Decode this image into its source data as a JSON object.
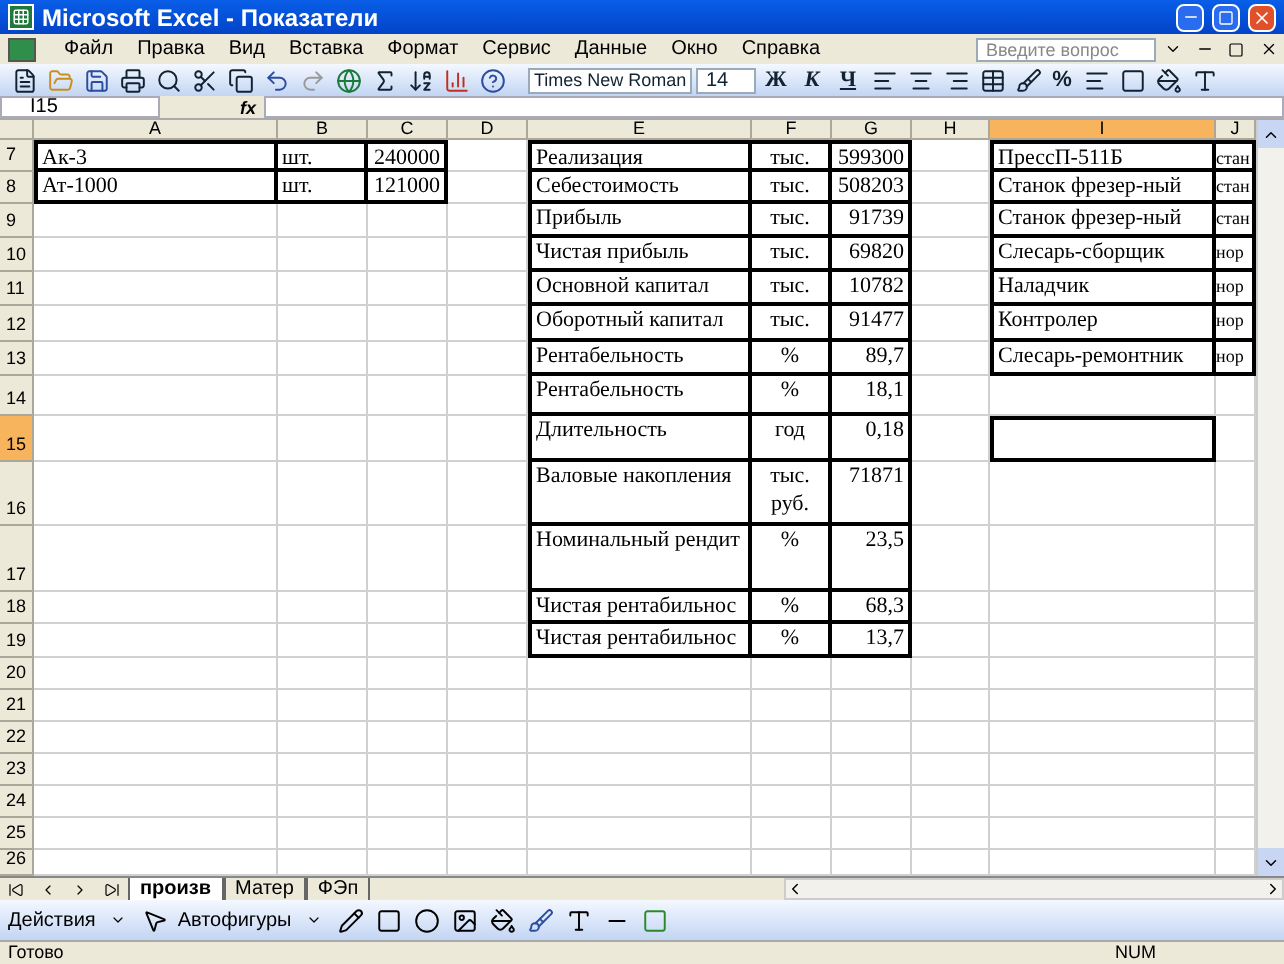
{
  "window": {
    "title": "Microsoft Excel - Показатели"
  },
  "menu": [
    {
      "label": "Файл"
    },
    {
      "label": "Правка"
    },
    {
      "label": "Вид"
    },
    {
      "label": "Вставка"
    },
    {
      "label": "Формат"
    },
    {
      "label": "Сервис"
    },
    {
      "label": "Данные"
    },
    {
      "label": "Окно"
    },
    {
      "label": "Справка"
    }
  ],
  "help_search": {
    "placeholder": "Введите вопрос"
  },
  "toolbar": {
    "font": "Times New Roman",
    "size": "14",
    "bold": "Ж",
    "italic": "К",
    "underline": "Ч",
    "percent": "%"
  },
  "formula_bar": {
    "name_box": "I15",
    "fx": "fx"
  },
  "columns": [
    {
      "label": "A",
      "selected": false
    },
    {
      "label": "B",
      "selected": false
    },
    {
      "label": "C",
      "selected": false
    },
    {
      "label": "D",
      "selected": false
    },
    {
      "label": "E",
      "selected": false
    },
    {
      "label": "F",
      "selected": false
    },
    {
      "label": "G",
      "selected": false
    },
    {
      "label": "H",
      "selected": false
    },
    {
      "label": "I",
      "selected": true
    },
    {
      "label": "J",
      "selected": false
    }
  ],
  "rows": [
    {
      "label": "7",
      "selected": false,
      "cells": {
        "A": "Ак-3",
        "B": "шт.",
        "C": "240000",
        "E": "Реализация",
        "F": "тыс.",
        "G": "599300",
        "I": "ПрессП-511Б",
        "J": "стан"
      }
    },
    {
      "label": "8",
      "selected": false,
      "cells": {
        "A": "Ат-1000",
        "B": "шт.",
        "C": "121000",
        "E": "Себестоимость",
        "F": "тыс.",
        "G": "508203",
        "I": "Станок фрезер-ный",
        "J": "стан"
      }
    },
    {
      "label": "9",
      "selected": false,
      "cells": {
        "E": "Прибыль",
        "F": "тыс.",
        "G": "91739",
        "I": "Станок фрезер-ный",
        "J": "стан"
      }
    },
    {
      "label": "10",
      "selected": false,
      "cells": {
        "E": "Чистая прибыль",
        "F": "тыс.",
        "G": "69820",
        "I": "Слесарь-сборщик",
        "J": "нор"
      }
    },
    {
      "label": "11",
      "selected": false,
      "cells": {
        "E": "Основной капитал",
        "F": "тыс.",
        "G": "10782",
        "I": "Наладчик",
        "J": "нор"
      }
    },
    {
      "label": "12",
      "selected": false,
      "cells": {
        "E": "Оборотный капитал",
        "F": "тыс.",
        "G": "91477",
        "I": "Контролер",
        "J": "нор"
      }
    },
    {
      "label": "13",
      "selected": false,
      "cells": {
        "E": "Рентабельность",
        "F": "%",
        "G": "89,7",
        "I": "Слесарь-ремонтник",
        "J": "нор"
      }
    },
    {
      "label": "14",
      "selected": false,
      "cells": {
        "E": "Рентабельность",
        "F": "%",
        "G": "18,1"
      }
    },
    {
      "label": "15",
      "selected": true,
      "cells": {
        "E": "Длительность",
        "F": "год",
        "G": "0,18"
      }
    },
    {
      "label": "16",
      "selected": false,
      "cells": {
        "E": "Валовые накопления",
        "F": "тыс. руб.",
        "G": "71871"
      }
    },
    {
      "label": "17",
      "selected": false,
      "cells": {
        "E": "Номинальный рендит",
        "F": "%",
        "G": "23,5"
      }
    },
    {
      "label": "18",
      "selected": false,
      "cells": {
        "E": "Чистая рентабильнос",
        "F": "%",
        "G": "68,3"
      }
    },
    {
      "label": "19",
      "selected": false,
      "cells": {
        "E": "Чистая рентабильнос",
        "F": "%",
        "G": "13,7"
      }
    },
    {
      "label": "20",
      "selected": false,
      "cells": {}
    },
    {
      "label": "21",
      "selected": false,
      "cells": {}
    },
    {
      "label": "22",
      "selected": false,
      "cells": {}
    },
    {
      "label": "23",
      "selected": false,
      "cells": {}
    },
    {
      "label": "24",
      "selected": false,
      "cells": {}
    },
    {
      "label": "25",
      "selected": false,
      "cells": {}
    },
    {
      "label": "26",
      "selected": false,
      "cells": {}
    }
  ],
  "sheet_tabs": [
    {
      "label": "произв",
      "selected": true
    },
    {
      "label": "Матер",
      "selected": false
    },
    {
      "label": "ФЭп",
      "selected": false
    }
  ],
  "drawing_toolbar": {
    "actions": "Действия",
    "autoshapes": "Автофигуры"
  },
  "status_bar": {
    "text": "Готово",
    "num": "NUM"
  }
}
